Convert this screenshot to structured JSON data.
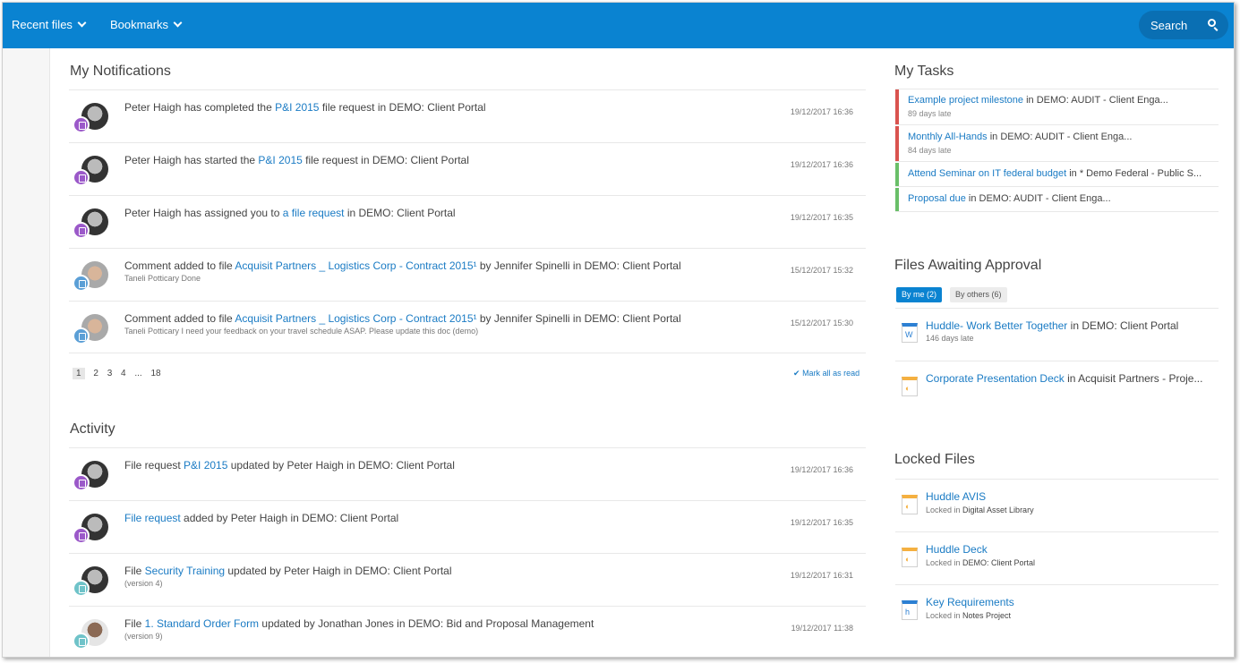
{
  "topbar": {
    "recent_files": "Recent files",
    "bookmarks": "Bookmarks",
    "search": "Search"
  },
  "notifications": {
    "title": "My Notifications",
    "items": [
      {
        "pre": "Peter Haigh has completed the ",
        "link": "P&I 2015",
        "post": " file request in DEMO: Client Portal",
        "sub": "",
        "time": "19/12/2017 16:36"
      },
      {
        "pre": "Peter Haigh has started the ",
        "link": "P&I 2015",
        "post": " file request in DEMO: Client Portal",
        "sub": "",
        "time": "19/12/2017 16:36"
      },
      {
        "pre": "Peter Haigh has assigned you to ",
        "link": "a file request",
        "post": " in DEMO: Client Portal",
        "sub": "",
        "time": "19/12/2017 16:35"
      },
      {
        "pre": "Comment added to file ",
        "link": "Acquisit Partners _ Logistics Corp - Contract 2015¹",
        "post": " by Jennifer Spinelli in DEMO: Client Portal",
        "sub": "Taneli Potticary Done",
        "time": "15/12/2017 15:32"
      },
      {
        "pre": "Comment added to file ",
        "link": "Acquisit Partners _ Logistics Corp - Contract 2015¹",
        "post": " by Jennifer Spinelli in DEMO: Client Portal",
        "sub": "Taneli Potticary I need your feedback on your travel schedule ASAP. Please update this doc (demo)",
        "time": "15/12/2017 15:30"
      }
    ],
    "pages": [
      "1",
      "2",
      "3",
      "4",
      "...",
      "18"
    ],
    "mark_all": "Mark all as read"
  },
  "activity": {
    "title": "Activity",
    "items": [
      {
        "pre": "File request ",
        "link": "P&I 2015",
        "post": " updated by Peter Haigh in DEMO: Client Portal",
        "sub": "",
        "time": "19/12/2017 16:36"
      },
      {
        "pre": " ",
        "link": "File request",
        "post": " added by Peter Haigh in DEMO: Client Portal",
        "sub": "",
        "time": "19/12/2017 16:35"
      },
      {
        "pre": "File ",
        "link": "Security Training",
        "post": " updated by Peter Haigh in DEMO: Client Portal",
        "sub": "(version 4)",
        "time": "19/12/2017 16:31"
      },
      {
        "pre": "File ",
        "link": "1. Standard Order Form",
        "post": " updated by Jonathan Jones in DEMO: Bid and Proposal Management",
        "sub": "(version 9)",
        "time": "19/12/2017 11:38"
      }
    ]
  },
  "tasks": {
    "title": "My Tasks",
    "items": [
      {
        "link": "Example project milestone",
        "post": " in DEMO: AUDIT - Client Enga...",
        "late": "89 days late",
        "color": "#d9534f"
      },
      {
        "link": "Monthly All-Hands",
        "post": " in DEMO: AUDIT - Client Enga...",
        "late": "84 days late",
        "color": "#d9534f"
      },
      {
        "link": "Attend Seminar on IT federal budget",
        "post": " in * Demo Federal - Public S...",
        "late": "",
        "color": "#6abf69"
      },
      {
        "link": "Proposal due",
        "post": " in DEMO: AUDIT - Client Enga...",
        "late": "",
        "color": "#6abf69"
      }
    ]
  },
  "approval": {
    "title": "Files Awaiting Approval",
    "tab_me": "By me (2)",
    "tab_others": "By others (6)",
    "files": [
      {
        "link": "Huddle- Work Better Together",
        "post": " in DEMO: Client Portal",
        "sub": "146 days late",
        "icon": "word-doc-icon"
      },
      {
        "link": "Corporate Presentation Deck",
        "post": " in Acquisit Partners - Proje...",
        "sub": "",
        "icon": "presentation-icon"
      }
    ]
  },
  "locked": {
    "title": "Locked Files",
    "locked_in": "Locked in ",
    "files": [
      {
        "name": "Huddle AVIS",
        "location": "Digital Asset Library",
        "icon": "presentation-icon"
      },
      {
        "name": "Huddle Deck",
        "location": "DEMO: Client Portal",
        "icon": "presentation-icon"
      },
      {
        "name": "Key Requirements",
        "location": "Notes Project",
        "icon": "note-icon"
      }
    ]
  }
}
